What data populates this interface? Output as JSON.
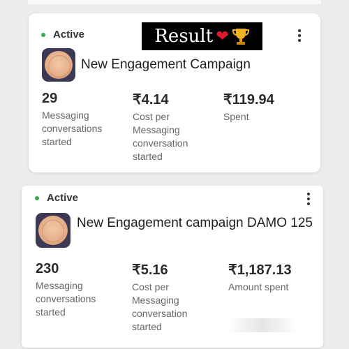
{
  "overlay": {
    "text": "Result",
    "icons": [
      "heart-icon",
      "trophy-icon"
    ],
    "heart_color": "#e0182d",
    "trophy_color": "#f2b320"
  },
  "status_color": "#34a853",
  "campaigns": [
    {
      "status": "Active",
      "name": "New Engagement Campaign",
      "metrics": [
        {
          "value": "29",
          "label": "Messaging conversations started"
        },
        {
          "value": "₹4.14",
          "label": "Cost per Messaging conversation started"
        },
        {
          "value": "₹119.94",
          "label": "Spent"
        }
      ]
    },
    {
      "status": "Active",
      "name": "New Engagement campaign DAMO 125",
      "metrics": [
        {
          "value": "230",
          "label": "Messaging conversations started"
        },
        {
          "value": "₹5.16",
          "label": "Cost per Messaging conversation started"
        },
        {
          "value": "₹1,187.13",
          "label": "Amount spent"
        }
      ]
    }
  ]
}
